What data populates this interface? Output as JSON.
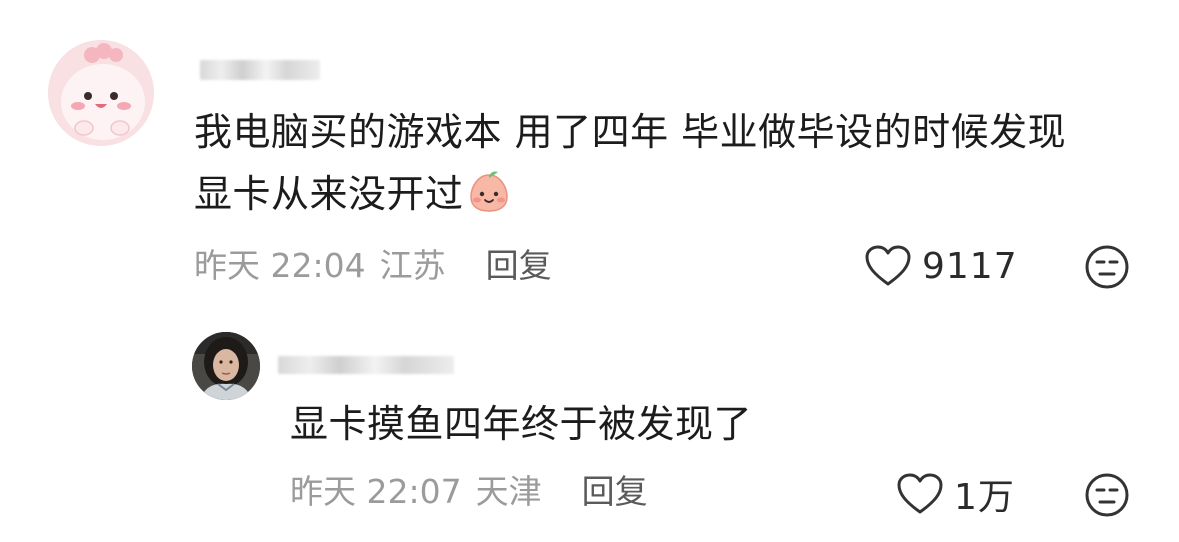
{
  "comments": [
    {
      "text_line1": "我电脑买的游戏本 用了四年 毕业做毕设的时候发现",
      "text_line2": "显卡从来没开过",
      "date": "昨天 22:04",
      "location": "江苏",
      "reply_label": "回复",
      "like_count": "9117",
      "avatar_icon": "cute-pink-blob-avatar",
      "inline_emoji_icon": "blushing-peach-emoji"
    },
    {
      "text": "显卡摸鱼四年终于被发现了",
      "date": "昨天 22:07",
      "location": "天津",
      "reply_label": "回复",
      "like_count": "1万",
      "avatar_icon": "portrait-photo-avatar"
    }
  ],
  "colors": {
    "text": "#1c1c1c",
    "meta": "#9b9b9b",
    "icon_stroke": "#333333"
  }
}
